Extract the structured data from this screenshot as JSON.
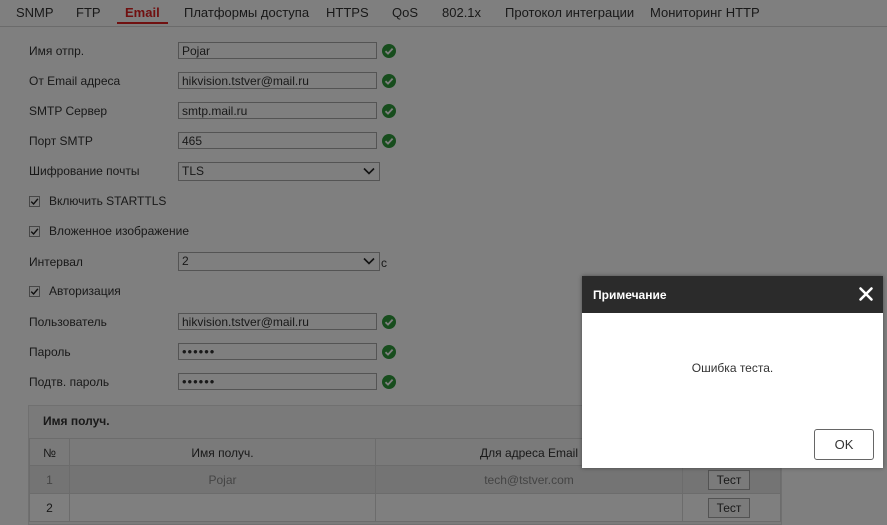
{
  "tabs": [
    "SNMP",
    "FTP",
    "Email",
    "Платформы доступа",
    "HTTPS",
    "QoS",
    "802.1x",
    "Протокол интеграции",
    "Мониторинг HTTP"
  ],
  "active_tab": "Email",
  "form": {
    "sender_name_label": "Имя отпр.",
    "sender_name_value": "Pojar",
    "from_email_label": "От Email адреса",
    "from_email_value": "hikvision.tstver@mail.ru",
    "smtp_server_label": "SMTP Сервер",
    "smtp_server_value": "smtp.mail.ru",
    "smtp_port_label": "Порт SMTP",
    "smtp_port_value": "465",
    "encryption_label": "Шифрование почты",
    "encryption_value": "TLS",
    "starttls_label": "Включить STARTTLS",
    "starttls_checked": true,
    "attach_image_label": "Вложенное изображение",
    "attach_image_checked": true,
    "interval_label": "Интервал",
    "interval_value": "2",
    "interval_unit": "с",
    "auth_label": "Авторизация",
    "auth_checked": true,
    "user_label": "Пользователь",
    "user_value": "hikvision.tstver@mail.ru",
    "password_label": "Пароль",
    "password_value": "••••••",
    "confirm_password_label": "Подтв. пароль",
    "confirm_password_value": "••••••"
  },
  "receivers": {
    "section_title": "Имя получ.",
    "columns": [
      "№",
      "Имя получ.",
      "Для адреса Email"
    ],
    "rows": [
      {
        "no": "1",
        "name": "Pojar",
        "email": "tech@tstver.com",
        "test_label": "Тест"
      },
      {
        "no": "2",
        "name": "",
        "email": "",
        "test_label": "Тест"
      }
    ]
  },
  "dialog": {
    "title": "Примечание",
    "message": "Ошибка теста.",
    "ok_label": "OK"
  },
  "colors": {
    "accent": "#e02020",
    "valid_icon": "#2e9a3a",
    "dialog_header": "#2b2b2b"
  }
}
